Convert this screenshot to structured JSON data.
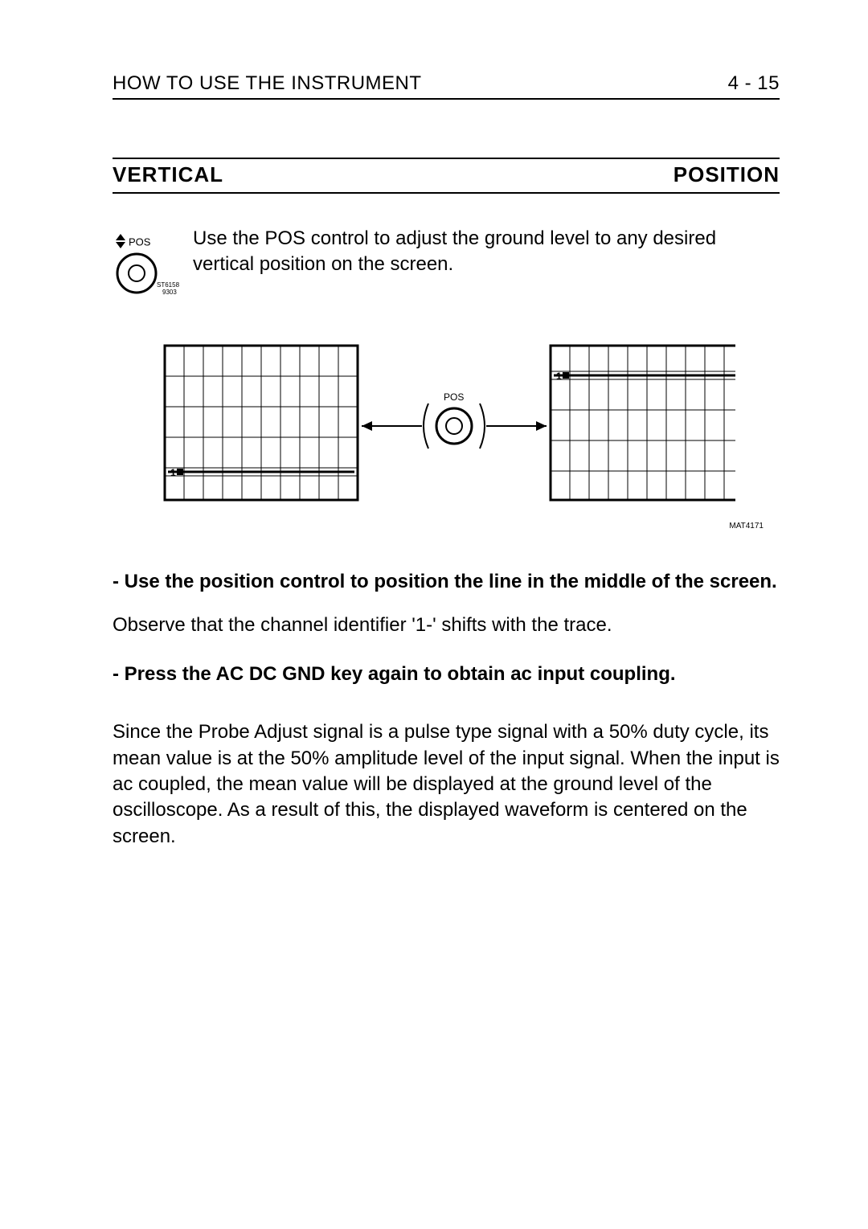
{
  "header": {
    "title": "HOW TO USE THE INSTRUMENT",
    "page_number": "4 - 15"
  },
  "section": {
    "left": "VERTICAL",
    "right": "POSITION"
  },
  "intro": {
    "knob_label": "POS",
    "knob_ref_id": "ST6158",
    "knob_ref_sub": "9303",
    "text": "Use the POS control to adjust the ground level to any desired vertical position on the screen."
  },
  "figure": {
    "center_knob_label": "POS",
    "id": "MAT4171",
    "left_marker": "1",
    "right_marker": "1"
  },
  "steps": {
    "step1": "- Use the position control to position the line in the middle of the screen.",
    "observe": "Observe that the channel identifier '1-' shifts with the trace.",
    "step2": "- Press the AC DC GND key again to obtain ac input coupling.",
    "explanation": "Since the Probe Adjust signal is a pulse type signal with a 50% duty cycle, its mean value is at the 50% amplitude level of the input signal. When the input is ac coupled, the mean value will be displayed at the ground level of the oscilloscope. As a result of this, the displayed waveform is centered on the screen."
  }
}
